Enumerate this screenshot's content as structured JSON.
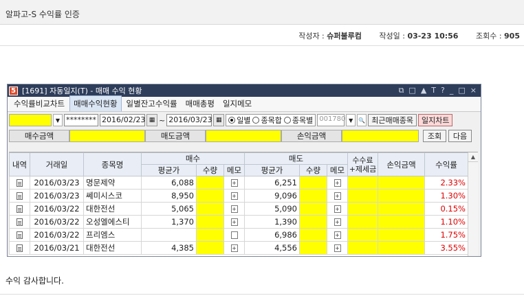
{
  "post": {
    "title": "알파고-S 수익률 인증",
    "author_label": "작성자 :",
    "author": "슈퍼불루컴",
    "date_label": "작성일 :",
    "date": "03-23 10:56",
    "views_label": "조회수 :",
    "views": "905",
    "body": "수익 감사합니다."
  },
  "window": {
    "badge": "5",
    "title": "[1691] 자동일지(T) - 매매 수익 현황",
    "icons": [
      "⧉",
      "□",
      "▲",
      "T",
      "?",
      "_",
      "□",
      "×"
    ]
  },
  "tabs": [
    "수익률비교차트",
    "매매수익현황",
    "일별잔고수익률",
    "매매총평",
    "일지메모"
  ],
  "toolbar": {
    "password": "********",
    "date_from": "2016/02/23",
    "tilde": "~",
    "date_to": "2016/03/23",
    "radio_options": [
      "일별",
      "종목합",
      "종목별"
    ],
    "selected_radio": "일별",
    "code": "001780",
    "recent_button": "최근매매종목",
    "chart_button": "일지차트"
  },
  "summary": {
    "buy_label": "매수금액",
    "sell_label": "매도금액",
    "pl_label": "손익금액",
    "query_button": "조회",
    "next_button": "다음"
  },
  "table": {
    "headers": {
      "detail": "내역",
      "date": "거래일",
      "name": "종목명",
      "buy": "매수",
      "sell": "매도",
      "fee": "수수료",
      "fee2": "+제세금",
      "pl": "손익금액",
      "rate": "수익률",
      "avg": "평균가",
      "qty": "수량",
      "memo": "메모"
    },
    "rows": [
      {
        "date": "2016/03/23",
        "name": "명문제약",
        "buy_avg": "6,088",
        "sell_avg": "6,251",
        "rate": "2.33%"
      },
      {
        "date": "2016/03/23",
        "name": "쎄미시스코",
        "buy_avg": "8,950",
        "sell_avg": "9,096",
        "rate": "1.30%"
      },
      {
        "date": "2016/03/22",
        "name": "대한전선",
        "buy_avg": "5,065",
        "sell_avg": "5,090",
        "rate": "0.15%"
      },
      {
        "date": "2016/03/22",
        "name": "오성엘에스티",
        "buy_avg": "1,370",
        "sell_avg": "1,390",
        "rate": "1.10%"
      },
      {
        "date": "2016/03/22",
        "name": "프리엠스",
        "buy_avg": "",
        "sell_avg": "6,986",
        "rate": "1.75%"
      },
      {
        "date": "2016/03/21",
        "name": "대한전선",
        "buy_avg": "4,385",
        "sell_avg": "4,556",
        "rate": "3.55%"
      }
    ]
  },
  "colors": {
    "highlight": "#ffff00",
    "profit": "#dd0000",
    "titlebar": "#2e3d5a"
  }
}
